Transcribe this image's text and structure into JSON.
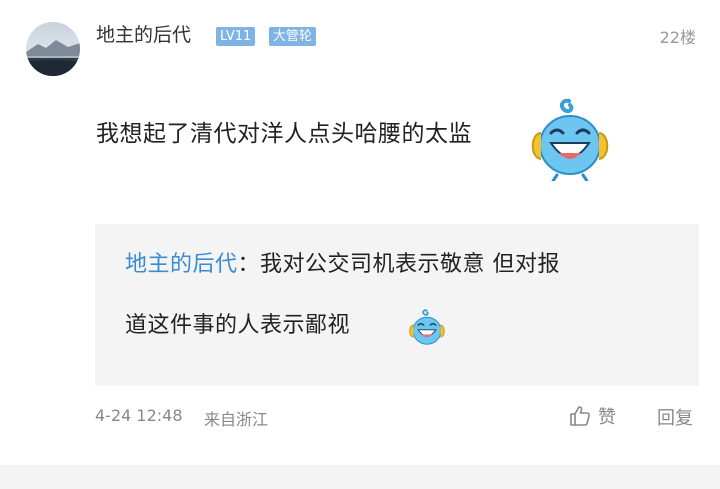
{
  "post": {
    "username": "地主的后代",
    "level_badge": "LV11",
    "title_badge": "大管轮",
    "floor": "22楼",
    "content": "我想起了清代对洋人点头哈腰的太监",
    "quote": {
      "author": "地主的后代",
      "separator": "：",
      "line1": "我对公交司机表示敬意 但对报",
      "line2": "道这件事的人表示鄙视"
    },
    "time": "4-24 12:48",
    "source": "来自浙江",
    "like_label": "赞",
    "reply_label": "回复"
  },
  "icons": {
    "avatar": "landscape-avatar",
    "emoji": "laughing-blue-mascot-emoji",
    "like": "thumbs-up-icon"
  },
  "colors": {
    "badge": "#7fb2e5",
    "quote_author": "#3b8bd4",
    "quote_bg": "#f4f4f4"
  }
}
